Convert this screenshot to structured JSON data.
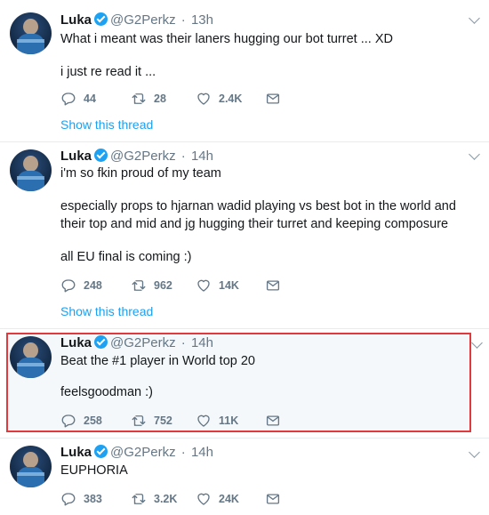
{
  "tweets": [
    {
      "name": "Luka",
      "handle": "@G2Perkz",
      "separator": "·",
      "time": "13h",
      "paragraphs": [
        "What i meant was their laners hugging our bot turret ... XD",
        "i just re read it ..."
      ],
      "replies": "44",
      "retweets": "28",
      "likes": "2.4K",
      "show_thread": "Show this thread"
    },
    {
      "name": "Luka",
      "handle": "@G2Perkz",
      "separator": "·",
      "time": "14h",
      "paragraphs": [
        "i'm so fkin proud of my team",
        "especially props to hjarnan wadid playing vs best bot in the world and their top and mid and jg hugging their turret and keeping composure",
        "all EU final is coming :)"
      ],
      "replies": "248",
      "retweets": "962",
      "likes": "14K",
      "show_thread": "Show this thread"
    },
    {
      "name": "Luka",
      "handle": "@G2Perkz",
      "separator": "·",
      "time": "14h",
      "paragraphs": [
        "Beat the #1 player in World top 20",
        "feelsgoodman :)"
      ],
      "replies": "258",
      "retweets": "752",
      "likes": "11K"
    },
    {
      "name": "Luka",
      "handle": "@G2Perkz",
      "separator": "·",
      "time": "14h",
      "paragraphs": [
        "EUPHORIA"
      ],
      "replies": "383",
      "retweets": "3.2K",
      "likes": "24K"
    }
  ],
  "icons": {
    "reply": "reply-icon",
    "retweet": "retweet-icon",
    "like": "heart-icon",
    "dm": "message-icon",
    "verified": "verified-badge-icon",
    "more": "chevron-down-icon"
  },
  "colors": {
    "accent": "#1da1f2",
    "highlight_border": "#e0393e",
    "muted": "#657786"
  }
}
